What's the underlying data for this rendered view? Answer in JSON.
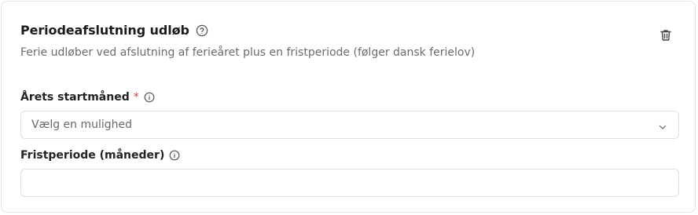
{
  "section": {
    "title": "Periodeafslutning udløb",
    "subtitle": "Ferie udløber ved afslutning af ferieåret plus en fristperiode (følger dansk ferielov)",
    "help_icon": "question-circle-icon",
    "delete_icon": "trash-icon"
  },
  "fields": {
    "start_month": {
      "label": "Årets startmåned",
      "required_marker": "*",
      "info_icon": "info-circle-icon",
      "selected_value": "Vælg en mulighed",
      "chevron_icon": "chevron-down-icon"
    },
    "grace_period": {
      "label": "Fristperiode (måneder)",
      "info_icon": "info-circle-icon",
      "value": ""
    }
  },
  "colors": {
    "required": "#d63a3a",
    "border": "#e0e0e0",
    "muted_text": "#6b6b6b"
  }
}
